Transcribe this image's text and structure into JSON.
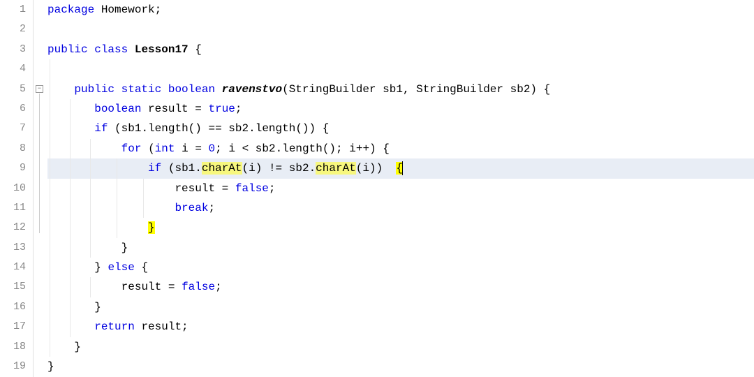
{
  "lineNumbers": [
    "1",
    "2",
    "3",
    "4",
    "5",
    "6",
    "7",
    "8",
    "9",
    "10",
    "11",
    "12",
    "13",
    "14",
    "15",
    "16",
    "17",
    "18",
    "19"
  ],
  "code": {
    "l1": {
      "kw_package": "package",
      "pkg": "Homework",
      "semi": ";"
    },
    "l3": {
      "kw_public": "public",
      "kw_class": "class",
      "classname": "Lesson17",
      "brace": "{"
    },
    "l5": {
      "kw_public": "public",
      "kw_static": "static",
      "kw_bool": "boolean",
      "method": "ravenstvo",
      "lp": "(",
      "t1": "StringBuilder",
      "p1": "sb1",
      "c": ",",
      "t2": "StringBuilder",
      "p2": "sb2",
      "rp": ")",
      "brace": "{"
    },
    "l6": {
      "kw_bool": "boolean",
      "var": "result",
      "eq": "=",
      "val": "true",
      "semi": ";"
    },
    "l7": {
      "kw_if": "if",
      "lp": "(",
      "a": "sb1",
      "dot1": ".",
      "m1": "length",
      "p1": "()",
      "op": "==",
      "b": "sb2",
      "dot2": ".",
      "m2": "length",
      "p2": "()",
      "rp": ")",
      "brace": "{"
    },
    "l8": {
      "kw_for": "for",
      "lp": "(",
      "t": "int",
      "v": "i",
      "eq": "=",
      "z": "0",
      "s1": ";",
      "v2": "i",
      "lt": "<",
      "b": "sb2",
      "dot": ".",
      "m": "length",
      "p": "()",
      "s2": ";",
      "v3": "i",
      "inc": "++",
      "rp": ")",
      "brace": "{"
    },
    "l9": {
      "kw_if": "if",
      "lp": "(",
      "a": "sb1",
      "d1": ".",
      "m1": "charAt",
      "lp1": "(",
      "i1": "i",
      "rp1": ")",
      "ne": "!=",
      "b": "sb2",
      "d2": ".",
      "m2": "charAt",
      "lp2": "(",
      "i2": "i",
      "rp2": ")",
      "rp": ")",
      "brace": "{"
    },
    "l10": {
      "var": "result",
      "eq": "=",
      "val": "false",
      "semi": ";"
    },
    "l11": {
      "kw_break": "break",
      "semi": ";"
    },
    "l12": {
      "brace": "}"
    },
    "l13": {
      "brace": "}"
    },
    "l14": {
      "brace1": "}",
      "kw_else": "else",
      "brace2": "{"
    },
    "l15": {
      "var": "result",
      "eq": "=",
      "val": "false",
      "semi": ";"
    },
    "l16": {
      "brace": "}"
    },
    "l17": {
      "kw_return": "return",
      "var": "result",
      "semi": ";"
    },
    "l18": {
      "brace": "}"
    },
    "l19": {
      "brace": "}"
    }
  },
  "activeLine": 9,
  "highlights": {
    "charAt1": "charAt",
    "charAt2": "charAt",
    "openBrace": "{",
    "closeBrace": "}"
  }
}
